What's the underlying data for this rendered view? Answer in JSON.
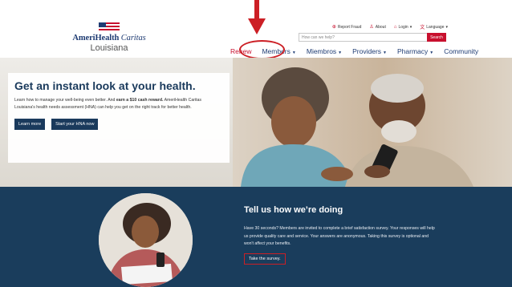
{
  "logo": {
    "brand_bold": "AmeriHealth",
    "brand_light": "Caritas",
    "state": "Louisiana"
  },
  "utility": {
    "report_fraud": "Report Fraud",
    "about": "About",
    "login": "Login",
    "language": "Language"
  },
  "search": {
    "placeholder": "How can we help?",
    "button": "Search"
  },
  "nav": {
    "renew": "Renew",
    "members": "Members",
    "miembros": "Miembros",
    "providers": "Providers",
    "pharmacy": "Pharmacy",
    "community": "Community"
  },
  "hero": {
    "title": "Get an instant look at your health.",
    "text_pre": "Learn how to manage your well-being even better. And ",
    "text_bold": "earn a $10 cash reward.",
    "text_post": " AmeriHealth Caritas Louisiana's health needs assessment (HNA) can help you get on the right track for better health.",
    "learn_more": "Learn more",
    "start_hna": "Start your HNA now"
  },
  "survey": {
    "title": "Tell us how we’re doing",
    "text": "Have 30 seconds? Members are invited to complete a brief satisfaction survey. Your responses will help us provide quality care and service. Your answers are anonymous. Taking this survey is optional and won't affect your benefits.",
    "button": "Take the survey."
  },
  "colors": {
    "brand_navy": "#1a3d5c",
    "brand_red": "#c8102e",
    "annotation_red": "#cc1f25"
  },
  "icons": [
    "flag-icon",
    "fraud-icon",
    "person-icon",
    "lock-icon",
    "translate-icon",
    "caret-down-icon"
  ]
}
